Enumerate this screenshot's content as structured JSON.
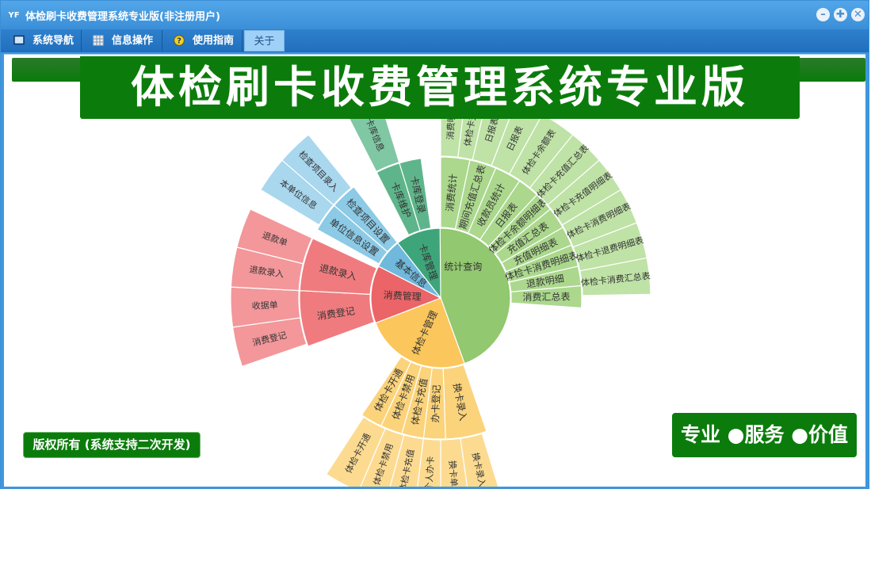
{
  "window": {
    "title": "体检刷卡收费管理系统专业版(非注册用户)",
    "app_icon": "YF"
  },
  "menu": [
    {
      "label": "系统导航",
      "icon": "monitor-icon"
    },
    {
      "label": "信息操作",
      "icon": "grid-icon"
    },
    {
      "label": "使用指南",
      "icon": "help-icon"
    },
    {
      "label": "关于",
      "icon": ""
    }
  ],
  "banner": {
    "title": "体检刷卡收费管理系统专业版"
  },
  "copyright": "版权所有 (系统支持二次开发)",
  "tagline": "专业 ●服务 ●价值",
  "sunburst": {
    "root": [
      {
        "label": "统计查询",
        "color": "#92c86f",
        "start": -88.5,
        "end": 160
      },
      {
        "label": "体检卡管理",
        "color": "#fbc65c",
        "start": 160,
        "end": 249
      },
      {
        "label": "消费管理",
        "color": "#eb6467",
        "start": 249,
        "end": 297
      },
      {
        "label": "基本信息",
        "color": "#70b9dc",
        "start": 297,
        "end": 322
      },
      {
        "label": "卡库管理",
        "color": "#3ea57a",
        "start": 322,
        "end": 359.5
      }
    ],
    "ring2": [
      {
        "label": "消费统计",
        "color": "#abd88d",
        "start": 0,
        "end": 12
      },
      {
        "label": "期间充值汇总表",
        "color": "#abd88d",
        "start": 12,
        "end": 23
      },
      {
        "label": "收款员统计",
        "color": "#abd88d",
        "start": 23,
        "end": 34
      },
      {
        "label": "日报表",
        "color": "#abd88d",
        "start": 34,
        "end": 43
      },
      {
        "label": "体检卡余额明细表",
        "color": "#abd88d",
        "start": 43,
        "end": 51
      },
      {
        "label": "充值汇总表",
        "color": "#abd88d",
        "start": 51,
        "end": 60
      },
      {
        "label": "充值明细表",
        "color": "#abd88d",
        "start": 60,
        "end": 68
      },
      {
        "label": "体检卡消费明细表",
        "color": "#abd88d",
        "start": 68,
        "end": 77
      },
      {
        "label": "退款明细",
        "color": "#abd88d",
        "start": 77,
        "end": 85
      },
      {
        "label": "消费汇总表",
        "color": "#abd88d",
        "start": 85,
        "end": 94
      },
      {
        "label": "换卡录入",
        "color": "#fbd37a",
        "start": 161,
        "end": 178
      },
      {
        "label": "办卡登记",
        "color": "#fbd37a",
        "start": 178,
        "end": 187
      },
      {
        "label": "体检卡充值",
        "color": "#fbd37a",
        "start": 187,
        "end": 196
      },
      {
        "label": "体检卡禁用",
        "color": "#fbd37a",
        "start": 196,
        "end": 205
      },
      {
        "label": "体检卡开通",
        "color": "#fbd37a",
        "start": 205,
        "end": 214
      },
      {
        "label": "消费登记",
        "color": "#ef7b7e",
        "start": 250,
        "end": 273
      },
      {
        "label": "退款录入",
        "color": "#ef7b7e",
        "start": 273,
        "end": 295
      },
      {
        "label": "单位信息设置",
        "color": "#8ccae6",
        "start": 299,
        "end": 311
      },
      {
        "label": "检查项目设置",
        "color": "#8ccae6",
        "start": 311,
        "end": 322
      },
      {
        "label": "卡库维护",
        "color": "#5fb58b",
        "start": 333,
        "end": 343
      },
      {
        "label": "卡库登录",
        "color": "#5fb58b",
        "start": 343,
        "end": 352
      }
    ],
    "ring3": [
      {
        "label": "消费明细",
        "color": "#bfe2a6",
        "start": 0,
        "end": 7
      },
      {
        "label": "体检卡充值",
        "color": "#bfe2a6",
        "start": 7,
        "end": 13
      },
      {
        "label": "日报表",
        "color": "#bfe2a6",
        "start": 13,
        "end": 21
      },
      {
        "label": "日报表",
        "color": "#bfe2a6",
        "start": 21,
        "end": 29
      },
      {
        "label": "体检卡余额表",
        "color": "#bfe2a6",
        "start": 29,
        "end": 39
      },
      {
        "label": "体检卡充值汇总表",
        "color": "#bfe2a6",
        "start": 39,
        "end": 49
      },
      {
        "label": "体检卡充值明细表",
        "color": "#bfe2a6",
        "start": 49,
        "end": 59
      },
      {
        "label": "体检卡消费明细表",
        "color": "#bfe2a6",
        "start": 59,
        "end": 69
      },
      {
        "label": "体检卡退费明细表",
        "color": "#bfe2a6",
        "start": 69,
        "end": 79
      },
      {
        "label": "体检卡消费汇总表",
        "color": "#bfe2a6",
        "start": 79,
        "end": 89
      },
      {
        "label": "换卡录入",
        "color": "#fcdb91",
        "start": 163,
        "end": 172
      },
      {
        "label": "换卡单",
        "color": "#fcdb91",
        "start": 172,
        "end": 180
      },
      {
        "label": "个人办卡",
        "color": "#fcdb91",
        "start": 180,
        "end": 187
      },
      {
        "label": "体检卡充值",
        "color": "#fcdb91",
        "start": 187,
        "end": 195
      },
      {
        "label": "体检卡禁用",
        "color": "#fcdb91",
        "start": 195,
        "end": 203
      },
      {
        "label": "体检卡开通",
        "color": "#fcdb91",
        "start": 203,
        "end": 213
      },
      {
        "label": "消费登记",
        "color": "#f3979a",
        "start": 251,
        "end": 262
      },
      {
        "label": "收据单",
        "color": "#f3979a",
        "start": 262,
        "end": 273
      },
      {
        "label": "退款录入",
        "color": "#f3979a",
        "start": 273,
        "end": 284
      },
      {
        "label": "退款单",
        "color": "#f3979a",
        "start": 284,
        "end": 295
      },
      {
        "label": "本单位信息",
        "color": "#a8d7ee",
        "start": 301,
        "end": 311
      },
      {
        "label": "检查项目录入",
        "color": "#a8d7ee",
        "start": 311,
        "end": 321
      },
      {
        "label": "卡库信息",
        "color": "#80c7a4",
        "start": 333,
        "end": 343
      }
    ]
  }
}
